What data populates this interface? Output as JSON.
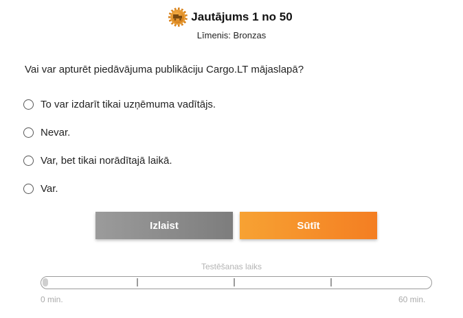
{
  "header": {
    "title": "Jautājums 1 no 50",
    "level": "Līmenis: Bronzas",
    "badge_icon": "bronze-truck-badge",
    "badge_color": "#d9841f"
  },
  "question": "Vai var apturēt piedāvājuma publikāciju Cargo.LT mājaslapā?",
  "options": [
    {
      "label": "To var izdarīt tikai uzņēmuma vadītājs.",
      "selected": false
    },
    {
      "label": "Nevar.",
      "selected": false
    },
    {
      "label": "Var, bet tikai norādītajā laikā.",
      "selected": false
    },
    {
      "label": "Var.",
      "selected": false
    }
  ],
  "buttons": {
    "skip": "Izlaist",
    "send": "Sūtīt",
    "skip_color": "#8c8c8c",
    "send_color": "#f58f2a"
  },
  "timer": {
    "label": "Testēšanas laiks",
    "min_label": "0 min.",
    "max_label": "60 min.",
    "progress": 0
  }
}
